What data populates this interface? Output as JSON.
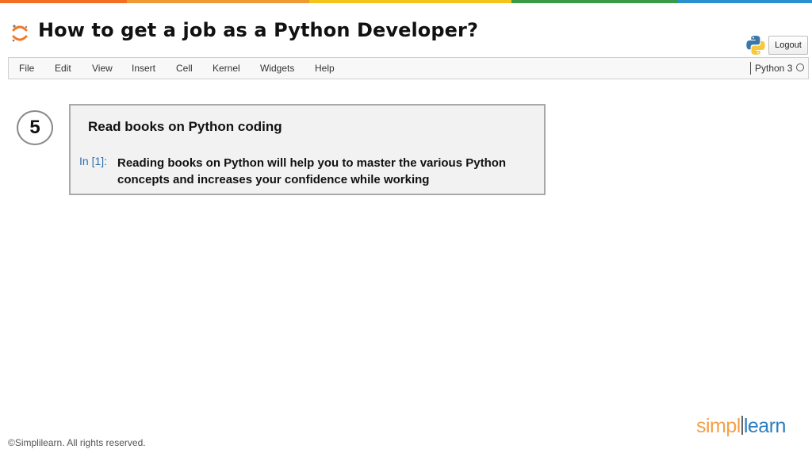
{
  "colors": {
    "strip": [
      "#f26f21",
      "#ef9b34",
      "#f4c41a",
      "#3a9a45",
      "#2a91cf"
    ],
    "accent_orange": "#f37726",
    "prompt_blue": "#2f6fb0",
    "brand_orange": "#f4a14a",
    "brand_blue": "#2b7fc0"
  },
  "header": {
    "logo_icon": "jupyter-logo-icon",
    "title": "How to get a job as a Python Developer?",
    "python_icon": "python-logo-icon",
    "logout_label": "Logout"
  },
  "menu": {
    "items": [
      "File",
      "Edit",
      "View",
      "Insert",
      "Cell",
      "Kernel",
      "Widgets",
      "Help"
    ],
    "kernel_name": "Python 3",
    "kernel_status_icon": "kernel-idle-circle-icon"
  },
  "step": {
    "number": "5"
  },
  "cell": {
    "heading": "Read books on Python coding",
    "prompt": "In [1]:",
    "text": "Reading books on Python will help you to master the various Python concepts and increases your confidence while working"
  },
  "footer": {
    "copyright": "©Simplilearn. All rights reserved.",
    "brand_left": "simpl",
    "brand_right": "learn"
  }
}
